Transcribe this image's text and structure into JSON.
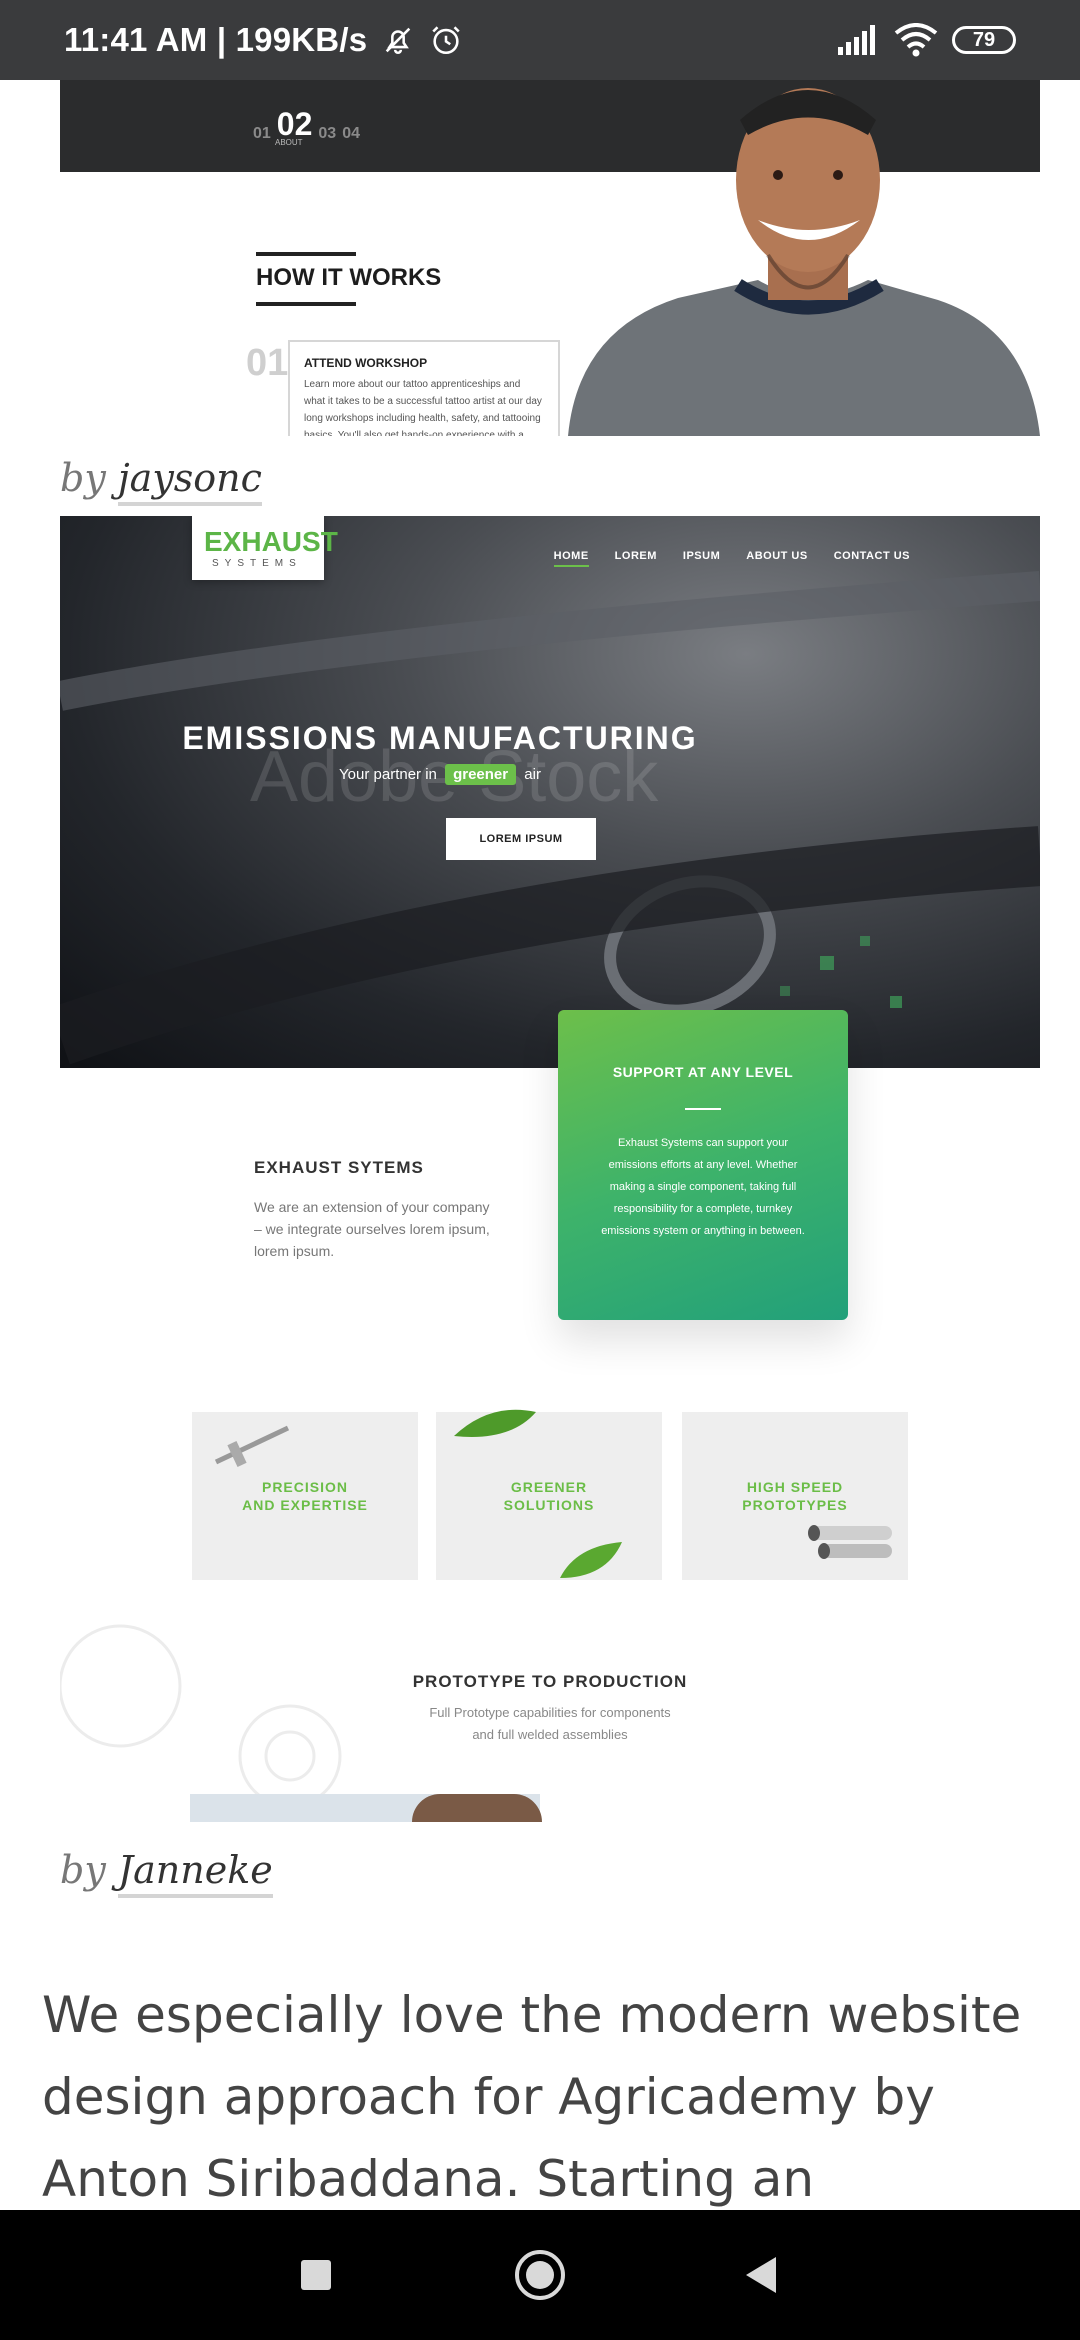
{
  "status_bar": {
    "time_speed": "11:41 AM | 199KB/s",
    "battery": "79",
    "icons": [
      "bell-off-icon",
      "alarm-icon",
      "signal-icon",
      "wifi-icon",
      "battery-icon"
    ]
  },
  "shot1": {
    "steps": [
      "01",
      "02",
      "03",
      "04"
    ],
    "active_step_label": "ABOUT",
    "section_title": "HOW IT WORKS",
    "step_number": "01",
    "card_title": "ATTEND WORKSHOP",
    "card_body": "Learn more about our tattoo apprenticeships and what it takes to be a successful tattoo artist at our day long workshops including health, safety, and tattooing basics. You'll also get hands-on experience with a"
  },
  "caption1": {
    "by": "by",
    "author": "jaysonc"
  },
  "shot2": {
    "logo_main": "EXHAUST",
    "logo_sub": "SYSTEMS",
    "nav": [
      "HOME",
      "LOREM",
      "IPSUM",
      "ABOUT US",
      "CONTACT US"
    ],
    "hero_title": "EMISSIONS MANUFACTURING",
    "hero_sub_before": "Your partner in",
    "hero_sub_chip": "greener",
    "hero_sub_after": "air",
    "hero_button": "LOREM IPSUM",
    "watermark": "Adobe Stock",
    "green_title": "SUPPORT AT ANY LEVEL",
    "green_body": "Exhaust Systems can support your emissions efforts at any level. Whether making a single component, taking full responsibility for a complete, turnkey emissions system or anything in between.",
    "exh_title": "EXHAUST SYTEMS",
    "exh_body": "We are an extension of your company – we integrate ourselves lorem ipsum, lorem ipsum.",
    "tiles": [
      "PRECISION\nAND EXPERTISE",
      "GREENER\nSOLUTIONS",
      "HIGH SPEED\nPROTOTYPES"
    ],
    "proto_title": "PROTOTYPE TO PRODUCTION",
    "proto_body_1": "Full Prototype capabilities for components",
    "proto_body_2": "and full welded assemblies"
  },
  "caption2": {
    "by": "by",
    "author": "Janneke"
  },
  "article": {
    "text": "We especially love the modern website design approach for Agricademy by Anton Siribaddana. Starting an"
  },
  "colors": {
    "accent_green": "#6cc04a",
    "status_bar": "#3a3b3d",
    "nav_bar": "#000000"
  }
}
